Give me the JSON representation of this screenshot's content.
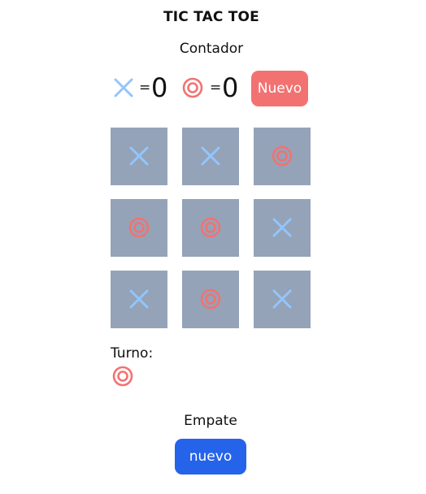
{
  "title": "TIC TAC TOE",
  "counter": {
    "label": "Contador",
    "x_icon": "x-icon",
    "o_icon": "o-ring-icon",
    "x_equals": "=",
    "x_score": "0",
    "o_equals": "=",
    "o_score": "0",
    "new_button_label": "Nuevo"
  },
  "board": {
    "cells": [
      "X",
      "X",
      "O",
      "O",
      "O",
      "X",
      "X",
      "O",
      "X"
    ]
  },
  "turn": {
    "label": "Turno:",
    "current": "O"
  },
  "status": "Empate",
  "reset_button_label": "nuevo",
  "colors": {
    "x": "#93c5fd",
    "o": "#f27272",
    "cell": "#94a3b8",
    "new_red": "#f27272",
    "new_blue": "#2563eb"
  }
}
